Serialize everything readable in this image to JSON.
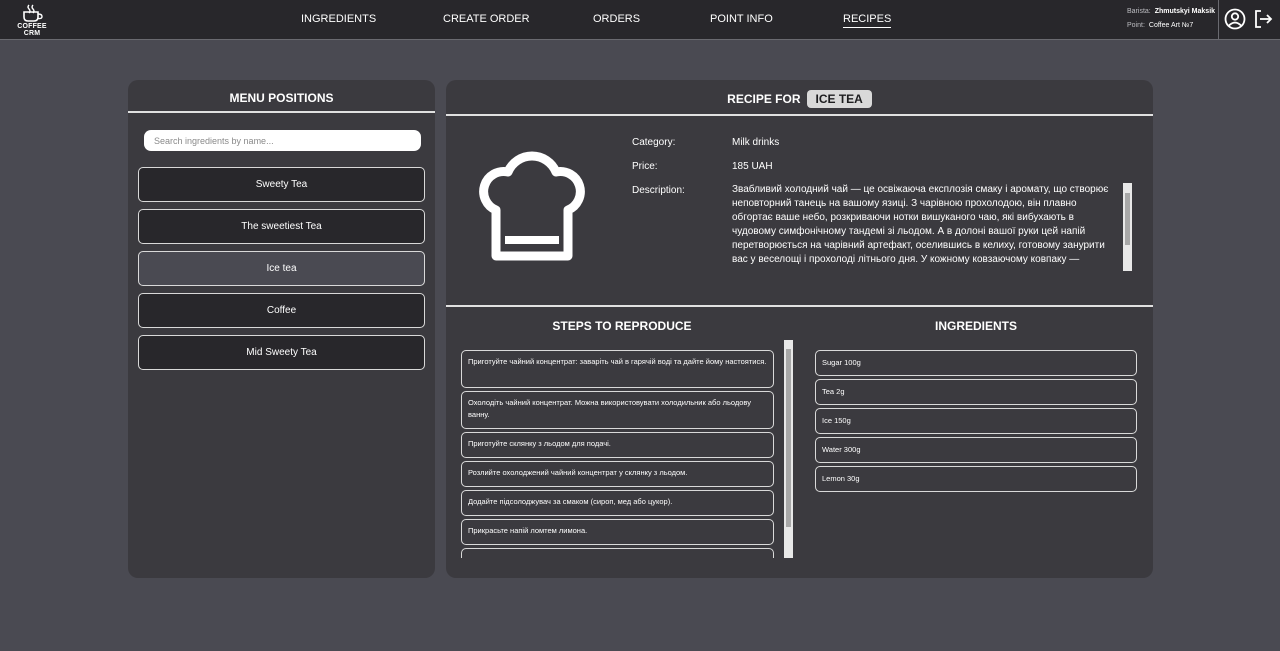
{
  "app": {
    "logo_text": "COFFEE CRM"
  },
  "nav": [
    {
      "label": "INGREDIENTS",
      "active": false
    },
    {
      "label": "CREATE ORDER",
      "active": false
    },
    {
      "label": "ORDERS",
      "active": false
    },
    {
      "label": "POINT INFO",
      "active": false
    },
    {
      "label": "RECIPES",
      "active": true
    }
  ],
  "user": {
    "barista_label": "Barista:",
    "barista_name": "Zhmutskyi Maksik",
    "point_label": "Point:",
    "point_name": "Coffee Art №7"
  },
  "icons": {
    "profile": "user-circle-icon",
    "logout": "logout-icon",
    "recipe": "chef-hat-icon",
    "logo": "coffee-cup-icon"
  },
  "menu": {
    "title": "MENU POSITIONS",
    "search_placeholder": "Search ingredients by name...",
    "items": [
      {
        "label": "Sweety Tea",
        "selected": false
      },
      {
        "label": "The sweetiest Tea",
        "selected": false
      },
      {
        "label": "Ice tea",
        "selected": true
      },
      {
        "label": "Coffee",
        "selected": false
      },
      {
        "label": "Mid Sweety Tea",
        "selected": false
      }
    ]
  },
  "recipe": {
    "title_prefix": "RECIPE FOR",
    "name": "ICE TEA",
    "category_label": "Category:",
    "category": "Milk drinks",
    "price_label": "Price:",
    "price": "185 UAH",
    "description_label": "Description:",
    "description": "Звабливий холодний чай — це освіжаюча експлозія смаку і аромату, що створює неповторний танець на вашому язиці. З чарівною прохолодою, він плавно обгортає ваше небо, розкриваючи нотки вишуканого чаю, які вибухають в чудовому симфонічному тандемі зі льодом. А в долоні вашої руки цей напій перетворюється на чарівний артефакт, оселившись в келиху, готовому занурити вас у веселощі і прохолоді літнього дня. У кожному ковзаючому ковпаку —"
  },
  "steps": {
    "title": "STEPS TO REPRODUCE",
    "items": [
      "Приготуйте чайний концентрат: заваріть чай в гарячій воді та дайте йому настоятися.",
      "Охолодіть чайний концентрат. Можна використовувати холодильник або льодову ванну.",
      "Приготуйте склянку з льодом для подачі.",
      "Розлийте охолоджений чайний концентрат у склянку з льодом.",
      "Додайте підсолоджувач за смаком (сироп, мед або цукор).",
      "Прикрасьте напій ломтем лимона."
    ]
  },
  "ingredients": {
    "title": "INGREDIENTS",
    "items": [
      "Sugar 100g",
      "Tea 2g",
      "Ice 150g",
      "Water 300g",
      "Lemon 30g"
    ]
  }
}
